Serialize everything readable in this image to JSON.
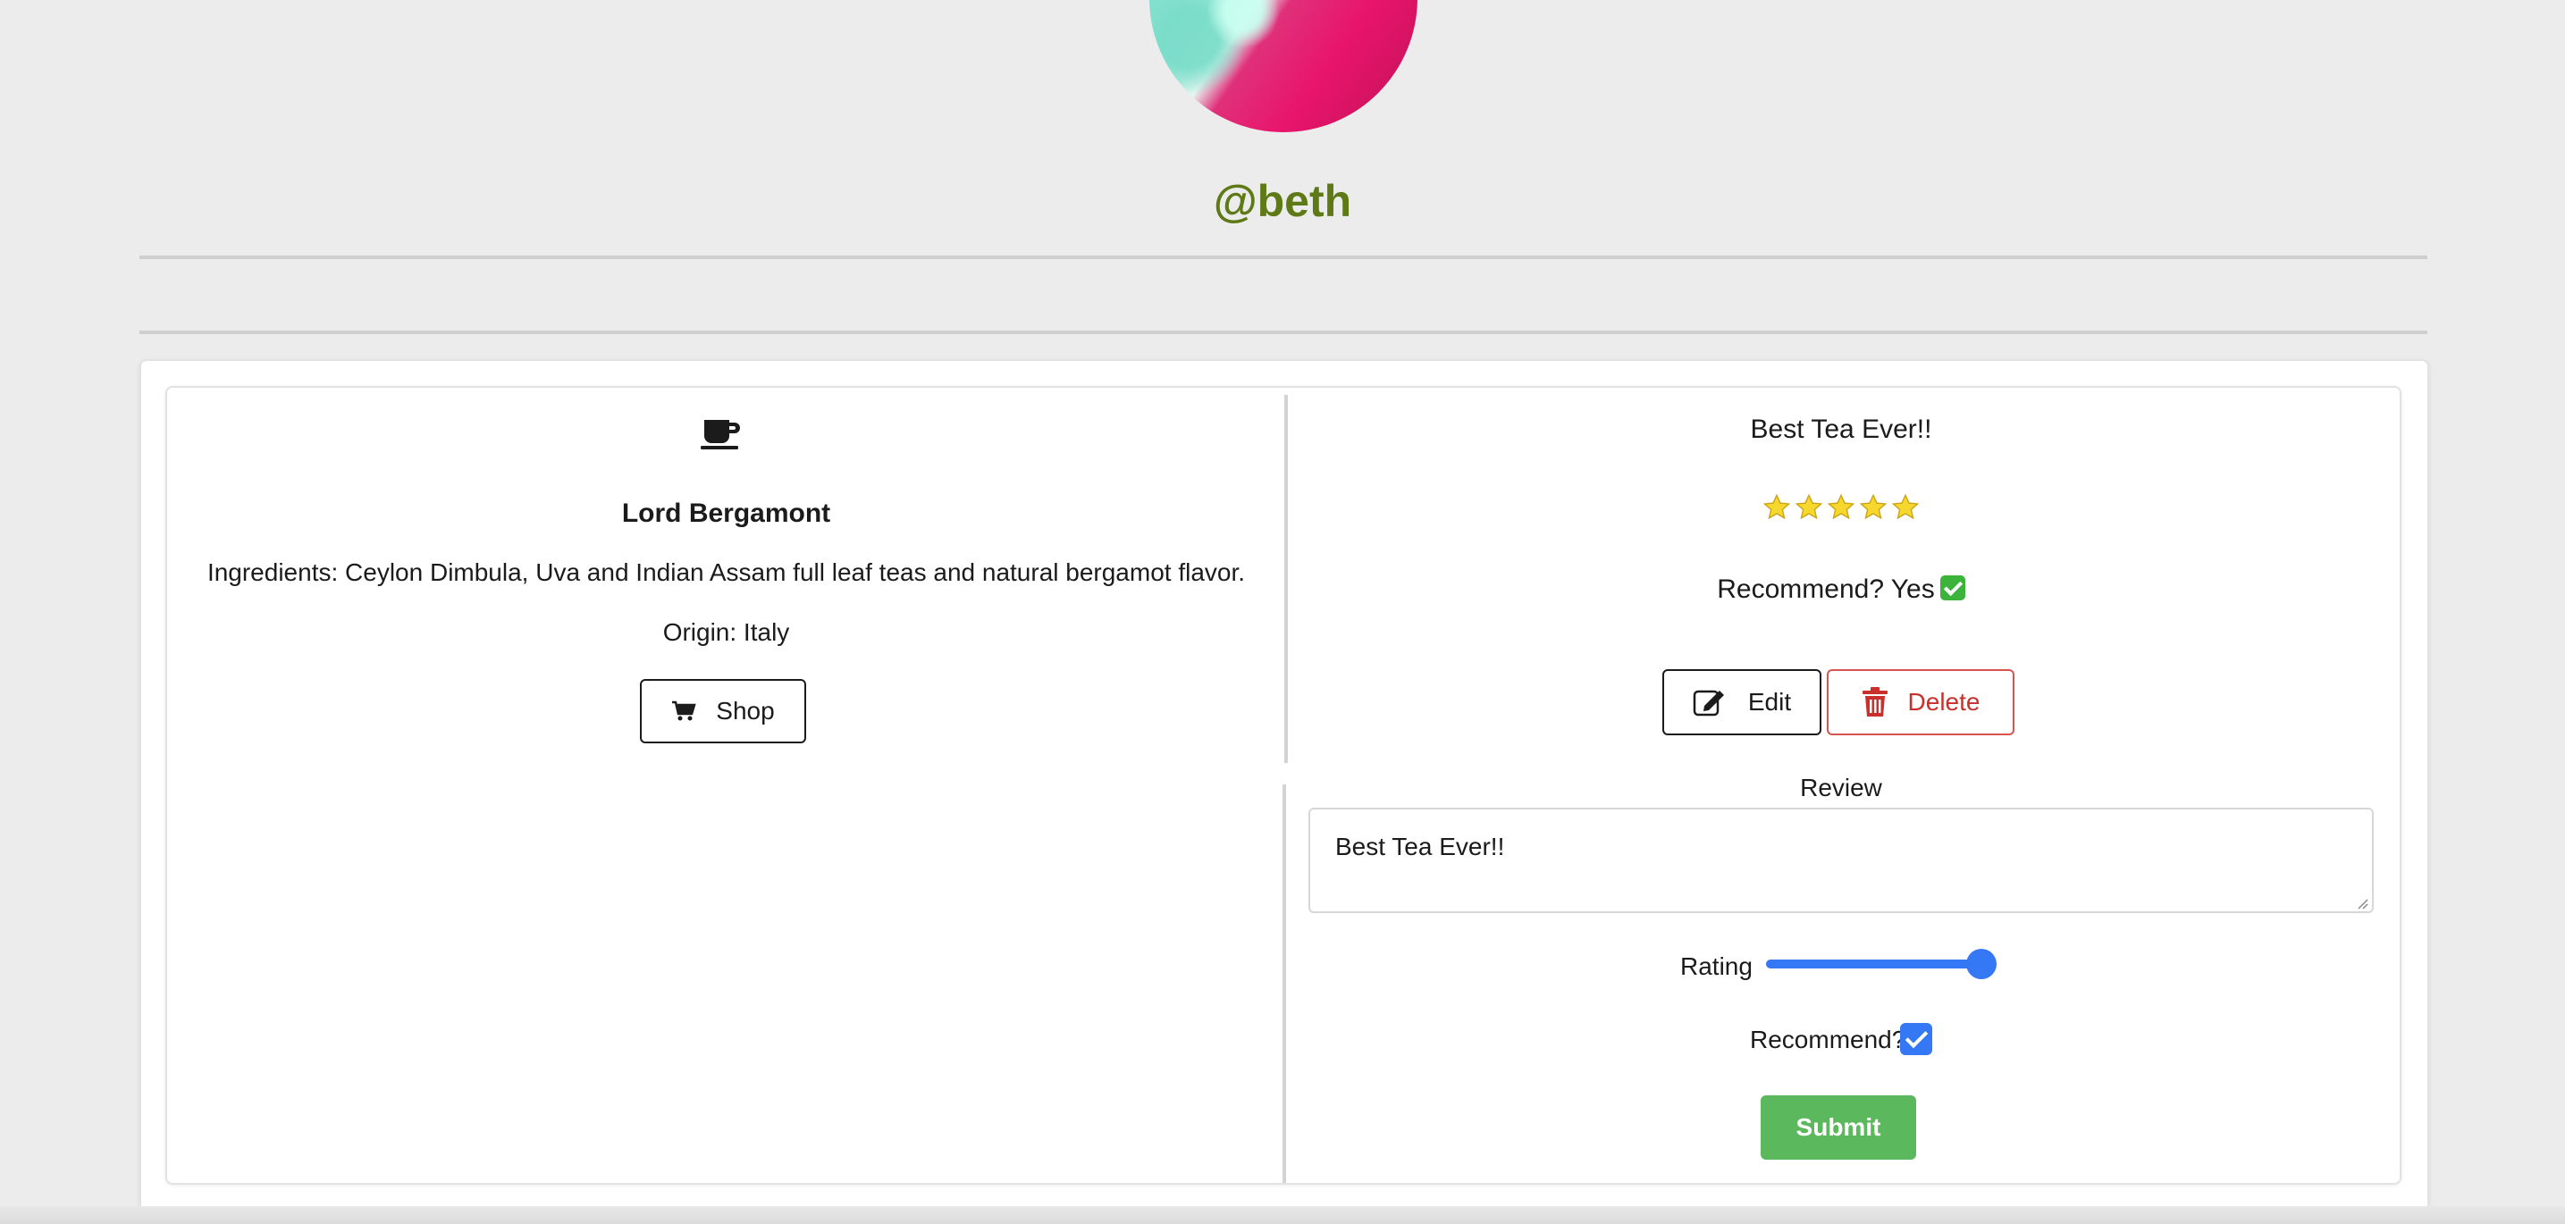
{
  "profile": {
    "username": "@beth"
  },
  "tea": {
    "icon": "coffee-cup-icon",
    "name": "Lord Bergamont",
    "ingredients": "Ingredients: Ceylon Dimbula, Uva and Indian Assam full leaf teas and natural bergamot flavor.",
    "origin": "Origin: Italy",
    "shop_label": "Shop"
  },
  "review": {
    "title": "Best Tea Ever!!",
    "stars": 5,
    "recommend_text": "Recommend? Yes",
    "edit_label": "Edit",
    "delete_label": "Delete"
  },
  "edit_form": {
    "review_label": "Review",
    "review_value": "Best Tea Ever!!",
    "rating_label": "Rating",
    "rating_value": 5,
    "rating_max": 5,
    "recommend_label": "Recommend?",
    "recommend_checked": true,
    "submit_label": "Submit"
  },
  "colors": {
    "background": "#edeced",
    "username": "#5e7a16",
    "accent": "#3478f6",
    "submit": "#5cb85c",
    "delete": "#d9534f"
  }
}
